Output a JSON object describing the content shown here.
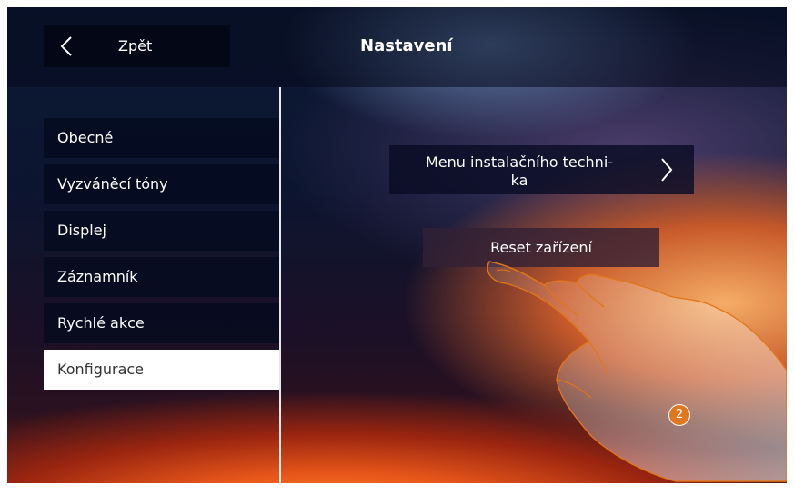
{
  "header": {
    "back_label": "Zpět",
    "title": "Nastavení"
  },
  "sidebar": {
    "items": [
      {
        "label": "Obecné"
      },
      {
        "label": "Vyzváněcí tóny"
      },
      {
        "label": "Displej"
      },
      {
        "label": "Záznamník"
      },
      {
        "label": "Rychlé akce"
      },
      {
        "label": "Konfigurace"
      }
    ],
    "active_item": "Konfigurace"
  },
  "main": {
    "installer_menu_label_line1": "Menu instalačního techni-",
    "installer_menu_label_line2": "ka",
    "reset_label": "Reset zařízení"
  },
  "annotation": {
    "step_number": "2"
  },
  "colors": {
    "accent_badge": "#e07820",
    "active_item_bg": "#ffffff",
    "active_item_text": "#333333"
  },
  "icons": {
    "back": "chevron-left-icon",
    "installer_menu": "chevron-right-icon",
    "pointer": "pointing-hand-icon"
  }
}
